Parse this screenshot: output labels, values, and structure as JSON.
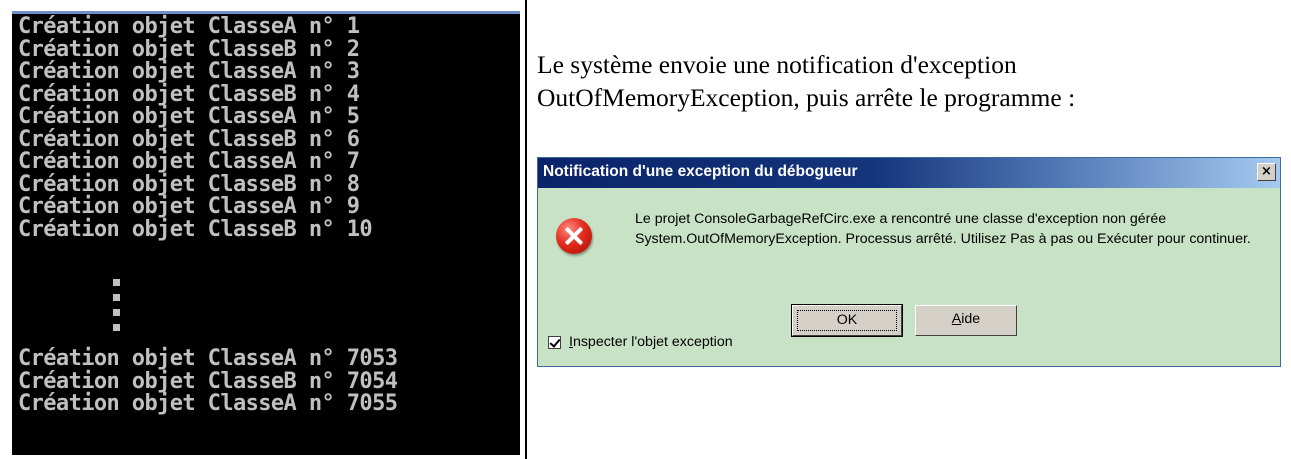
{
  "console": {
    "lines_top": [
      "Création objet ClasseA n° 1",
      "Création objet ClasseB n° 2",
      "Création objet ClasseA n° 3",
      "Création objet ClasseB n° 4",
      "Création objet ClasseA n° 5",
      "Création objet ClasseB n° 6",
      "Création objet ClasseA n° 7",
      "Création objet ClasseB n° 8",
      "Création objet ClasseA n° 9",
      "Création objet ClasseB n° 10"
    ],
    "lines_bottom": [
      "Création objet ClasseA n° 7053",
      "Création objet ClasseB n° 7054",
      "Création objet ClasseA n° 7055"
    ],
    "text_color": "#c0c0c0",
    "background": "#000000"
  },
  "description": {
    "line1": "Le système envoie une notification d'exception",
    "line2": "OutOfMemoryException, puis arrête le programme :"
  },
  "dialog": {
    "title": "Notification d'une exception du débogueur",
    "close_label": "×",
    "icon": "error-icon",
    "message": "Le projet ConsoleGarbageRefCirc.exe a rencontré une classe d'exception non gérée System.OutOfMemoryException. Processus arrêté. Utilisez Pas à pas ou Exécuter pour continuer.",
    "checkbox": {
      "label_first": "I",
      "label_rest": "nspecter l'objet exception",
      "checked": true
    },
    "ok_label": "OK",
    "help_first": "A",
    "help_rest": "ide",
    "background": "#c8e2c5",
    "title_color": "#0a246a"
  }
}
